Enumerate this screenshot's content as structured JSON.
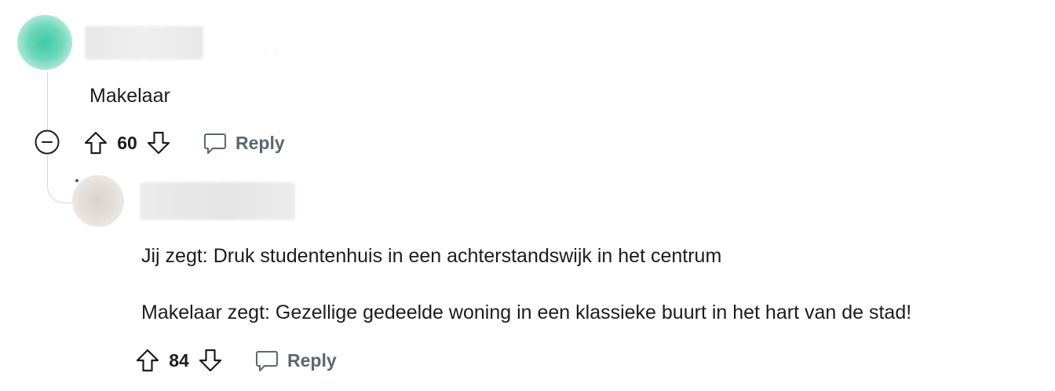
{
  "comments": [
    {
      "body": "Makelaar",
      "votes": "60",
      "reply_label": "Reply",
      "avatar_color": "#3ec9a4"
    },
    {
      "body_lines": [
        "Jij zegt: Druk studentenhuis in een achterstandswijk in het centrum",
        "Makelaar zegt: Gezellige gedeelde woning in een klassieke buurt in het hart van de stad!"
      ],
      "votes": "84",
      "reply_label": "Reply",
      "avatar_color": "#ddd6d2"
    }
  ],
  "icons": {
    "collapse": "minus-circle-icon",
    "upvote": "arrow-up-icon",
    "downvote": "arrow-down-icon",
    "reply": "speech-bubble-icon"
  },
  "colors": {
    "text": "#1c1c1c",
    "muted": "#5b6770",
    "thread_line": "#d7d7d7"
  }
}
